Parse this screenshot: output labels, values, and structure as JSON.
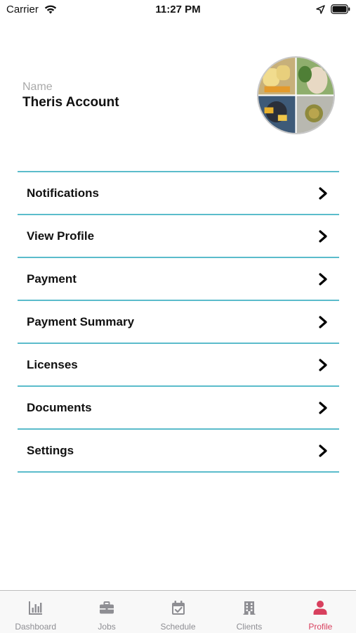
{
  "status_bar": {
    "carrier": "Carrier",
    "time": "11:27 PM",
    "icons": [
      "wifi-icon",
      "location-arrow-icon",
      "battery-icon"
    ]
  },
  "profile": {
    "name_label": "Name",
    "name_value": "Theris Account",
    "avatar": "food-collage-avatar"
  },
  "menu": {
    "items": [
      {
        "label": "Notifications",
        "icon": "chevron-right-icon"
      },
      {
        "label": "View Profile",
        "icon": "chevron-right-icon"
      },
      {
        "label": "Payment",
        "icon": "chevron-right-icon"
      },
      {
        "label": "Payment Summary",
        "icon": "chevron-right-icon"
      },
      {
        "label": "Licenses",
        "icon": "chevron-right-icon"
      },
      {
        "label": "Documents",
        "icon": "chevron-right-icon"
      },
      {
        "label": "Settings",
        "icon": "chevron-right-icon"
      }
    ]
  },
  "tab_bar": {
    "tabs": [
      {
        "label": "Dashboard",
        "icon": "bar-chart-icon",
        "active": false
      },
      {
        "label": "Jobs",
        "icon": "briefcase-icon",
        "active": false
      },
      {
        "label": "Schedule",
        "icon": "calendar-check-icon",
        "active": false
      },
      {
        "label": "Clients",
        "icon": "building-icon",
        "active": false
      },
      {
        "label": "Profile",
        "icon": "user-icon",
        "active": true
      }
    ]
  },
  "colors": {
    "divider": "#5bbccb",
    "active_tab": "#d8405e",
    "inactive_tab": "#8e8e93",
    "name_label": "#a9a9a9"
  }
}
